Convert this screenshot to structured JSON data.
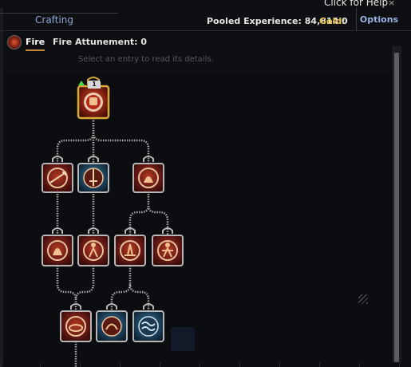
{
  "header": {
    "crafting_tab": "Crafting",
    "help_text": "Click for Help",
    "help_close": "×",
    "pooled_experience_label": "Pooled Experience:",
    "pooled_experience_value": "84,814",
    "gold_label": "Gold:",
    "gold_value": "0",
    "options_label": "Options"
  },
  "school_tabs": {
    "fire_label": "Fire",
    "attunement_label": "Fire Attunement:",
    "attunement_value": "0"
  },
  "details_hint": "Select an entry to read its details.",
  "skill_tree": {
    "root_rank": "1",
    "colors": {
      "frame_gold": "#d9a93a",
      "frame_silver": "#b7b7b7",
      "red_fill": "#7a1c1a",
      "blue_fill": "#224a66",
      "connector": "#a8a8a8"
    },
    "nodes": [
      {
        "id": "root",
        "icon": "fist-flame-icon",
        "state": "learned"
      },
      {
        "id": "t2-a",
        "icon": "fire-arrow-icon",
        "state": "available"
      },
      {
        "id": "t2-b",
        "icon": "flaming-sword-icon",
        "state": "available"
      },
      {
        "id": "t2-c",
        "icon": "campfire-icon",
        "state": "available"
      },
      {
        "id": "t3-a",
        "icon": "fire-hand-icon",
        "state": "available"
      },
      {
        "id": "t3-b",
        "icon": "burning-figure-icon",
        "state": "available"
      },
      {
        "id": "t3-c",
        "icon": "fire-pillar-icon",
        "state": "available"
      },
      {
        "id": "t3-d",
        "icon": "fire-mage-icon",
        "state": "available"
      },
      {
        "id": "t4-a",
        "icon": "fire-ring-icon",
        "state": "available"
      },
      {
        "id": "t4-b",
        "icon": "fire-swirl-icon",
        "state": "available"
      },
      {
        "id": "t4-c",
        "icon": "water-swirl-icon",
        "state": "available"
      }
    ]
  }
}
